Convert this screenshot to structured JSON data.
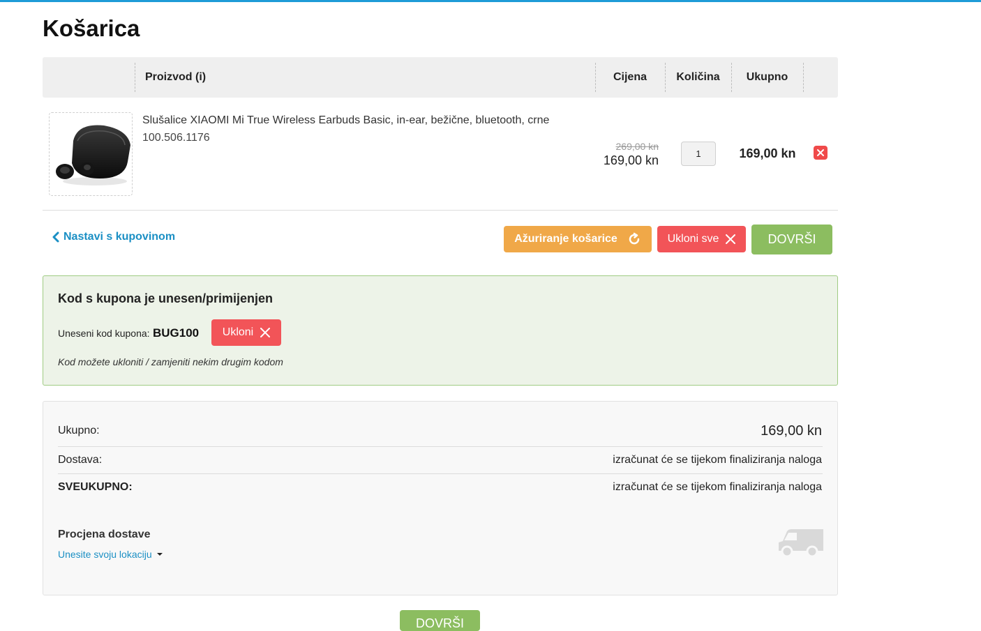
{
  "page": {
    "title": "Košarica"
  },
  "table": {
    "headers": {
      "product": "Proizvod (i)",
      "price": "Cijena",
      "qty": "Količina",
      "total": "Ukupno"
    },
    "rows": [
      {
        "name": "Slušalice XIAOMI Mi True Wireless Earbuds Basic, in-ear, bežične, bluetooth, crne",
        "code": "100.506.1176",
        "old_price": "269,00 kn",
        "price": "169,00 kn",
        "qty": "1",
        "total": "169,00 kn"
      }
    ]
  },
  "actions": {
    "continue": "Nastavi s kupovinom",
    "update": "Ažuriranje košarice",
    "clear": "Ukloni sve",
    "finish": "DOVRŠI"
  },
  "coupon": {
    "title": "Kod s kupona je unesen/primijenjen",
    "label": "Uneseni kod kupona:",
    "code": "BUG100",
    "remove": "Ukloni",
    "note": "Kod možete ukloniti / zamjeniti nekim drugim kodom"
  },
  "totals": {
    "subtotal_label": "Ukupno:",
    "subtotal_value": "169,00 kn",
    "shipping_label": "Dostava:",
    "shipping_value": "izračunat će se tijekom finaliziranja naloga",
    "grand_label": "SVEUKUPNO:",
    "grand_value": "izračunat će se tijekom finaliziranja naloga"
  },
  "estimate": {
    "title": "Procjena dostave",
    "link": "Unesite svoju lokaciju"
  },
  "colors": {
    "accent_blue": "#1a8fc4",
    "update_orange": "#f0a848",
    "remove_red": "#f25458",
    "finish_green": "#8cbd60"
  },
  "icons": {
    "continue": "chevron-left-icon",
    "update": "refresh-icon",
    "clear": "close-icon",
    "delete": "delete-icon",
    "estimate": "caret-down-icon",
    "truck": "truck-icon"
  }
}
